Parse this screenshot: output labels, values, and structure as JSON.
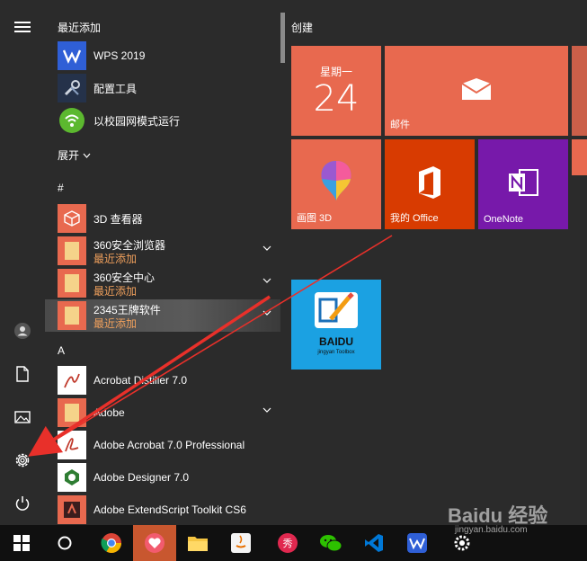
{
  "apps": {
    "recent_header": "最近添加",
    "recent": [
      "WPS 2019",
      "配置工具",
      "以校园网模式运行"
    ],
    "expand_label": "展开",
    "hash_header": "#",
    "items_hash": [
      {
        "name": "3D 查看器",
        "sub": ""
      },
      {
        "name": "360安全浏览器",
        "sub": "最近添加"
      },
      {
        "name": "360安全中心",
        "sub": "最近添加"
      },
      {
        "name": "2345王牌软件",
        "sub": "最近添加"
      }
    ],
    "a_header": "A",
    "items_a": [
      "Acrobat Distiller 7.0",
      "Adobe",
      "Adobe Acrobat 7.0 Professional",
      "Adobe Designer 7.0",
      "Adobe ExtendScript Toolkit CS6"
    ]
  },
  "tiles": {
    "group_title": "创建",
    "calendar": {
      "weekday": "星期一",
      "day": "24"
    },
    "mail": "邮件",
    "paint3d": "画图 3D",
    "office": "我的 Office",
    "onenote": "OneNote",
    "baidu": {
      "name": "BAIDU",
      "sub": "jingyan Toolbox"
    }
  },
  "watermark": {
    "brand": "Baidu 经验",
    "url": "jingyan.baidu.com"
  },
  "colors": {
    "tile_orange": "#e8694f",
    "office_red": "#d83b01",
    "onenote_purple": "#7719aa",
    "baidu_blue": "#1ba1e2",
    "accent_subtext": "#f0a05c",
    "arrow_red": "#e8302a"
  }
}
